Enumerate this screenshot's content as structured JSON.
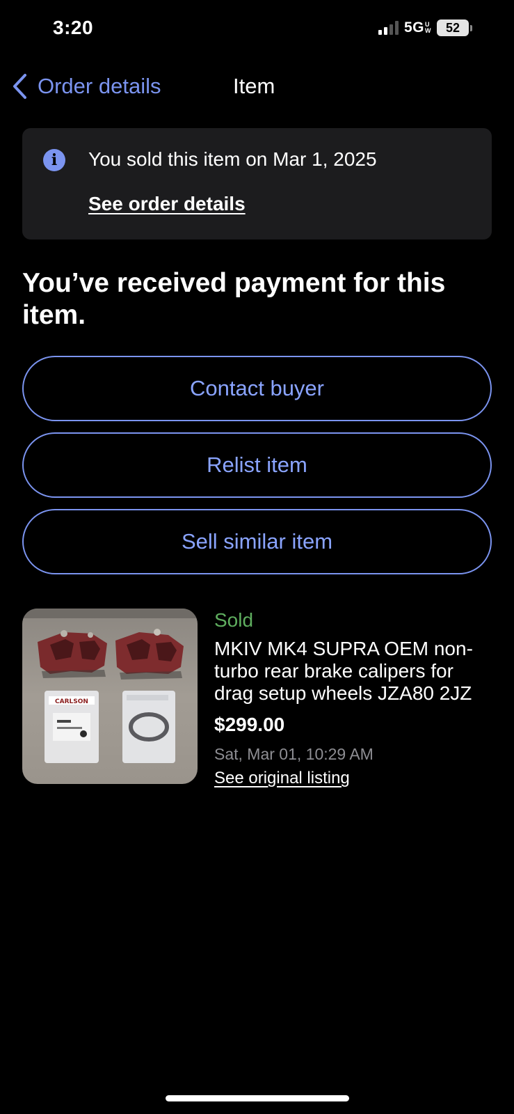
{
  "status_bar": {
    "time": "3:20",
    "network": "5G",
    "network_suffix_top": "U",
    "network_suffix_bottom": "W",
    "battery": "52"
  },
  "nav": {
    "back_label": "Order details",
    "title": "Item"
  },
  "info_card": {
    "message": "You sold this item on Mar 1, 2025",
    "link": "See order details"
  },
  "headline": "You’ve received payment for this item.",
  "actions": {
    "contact_buyer": "Contact buyer",
    "relist_item": "Relist item",
    "sell_similar": "Sell similar item"
  },
  "item": {
    "status": "Sold",
    "title": "MKIV MK4 SUPRA OEM non-turbo rear brake calipers for drag setup wheels JZA80 2JZ",
    "price": "$299.00",
    "date": "Sat, Mar 01, 10:29 AM",
    "link": "See original listing",
    "photo_label": "CARLSON"
  },
  "colors": {
    "accent": "#7b94f0",
    "sold_green": "#5fae5f",
    "card_bg": "#1c1c1e",
    "background": "#000000"
  }
}
